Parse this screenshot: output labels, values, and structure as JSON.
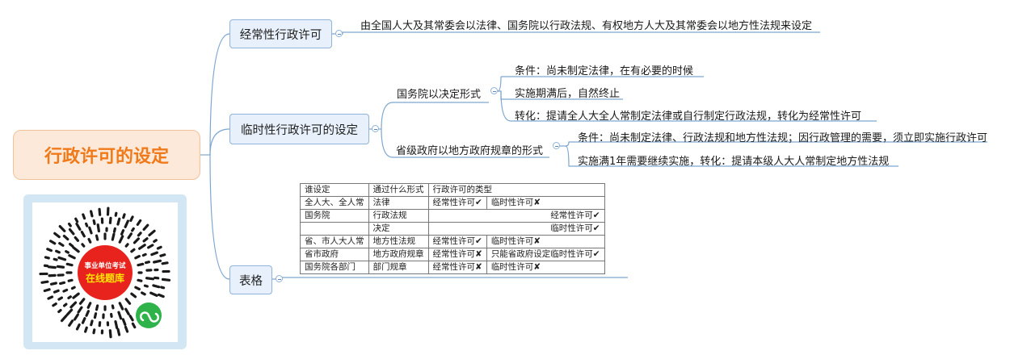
{
  "root": {
    "title": "行政许可的设定"
  },
  "branches": {
    "regular": {
      "label": "经常性行政许可",
      "detail": "由全国人大及其常委会以法律、国务院以行政法规、有权地方人大及其常委会以地方性法规来设定"
    },
    "temporary": {
      "label": "临时性行政许可的设定",
      "state_council": {
        "label": "国务院以决定形式",
        "items": [
          "条件：尚未制定法律，在有必要的时候",
          "实施期满后，自然终止",
          "转化：提请全人大全人常制定法律或自行制定行政法规，转化为经常性许可"
        ]
      },
      "provincial": {
        "label": "省级政府以地方政府规章的形式",
        "items": [
          "条件：尚未制定法律、行政法规和地方性法规；因行政管理的需要，须立即实施行政许可",
          "实施满1年需要继续实施，转化：提请本级人大人常制定地方性法规"
        ]
      }
    },
    "table": {
      "label": "表格",
      "headers": [
        "谁设定",
        "通过什么形式",
        "行政许可的类型"
      ],
      "rows": [
        [
          "全人大、全人常",
          "法律",
          "经常性许可✔",
          "临时性许可✘"
        ],
        [
          "国务院",
          "行政法规",
          "经常性许可✔"
        ],
        [
          "",
          "决定",
          "临时性许可✔"
        ],
        [
          "省、市人大人常",
          "地方性法规",
          "经常性许可✔",
          "临时性许可✘"
        ],
        [
          "省市政府",
          "地方政府规章",
          "经常性许可✘",
          "只能省政府设定临时性许可✔"
        ],
        [
          "国务院各部门",
          "部门规章",
          "经常性许可✘",
          "临时性许可✘"
        ]
      ]
    }
  },
  "qr": {
    "line1": "事业单位考试",
    "line2": "在线题库",
    "colors": {
      "center": "#e8231e",
      "text_top": "#ffffff",
      "text_bottom": "#ffe600",
      "logo": "#2db34a"
    }
  }
}
